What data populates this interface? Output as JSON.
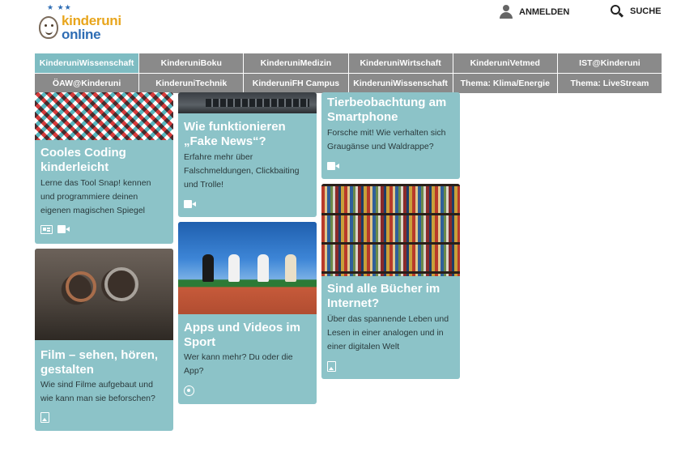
{
  "header": {
    "logo_line1": "kinderuni",
    "logo_line2": "online",
    "login_label": "ANMELDEN",
    "search_label": "SUCHE"
  },
  "nav": {
    "row1": [
      {
        "label": "KinderuniWissenschaft",
        "active": true
      },
      {
        "label": "KinderuniBoku"
      },
      {
        "label": "KinderuniMedizin"
      },
      {
        "label": "KinderuniWirtschaft"
      },
      {
        "label": "KinderuniVetmed"
      },
      {
        "label": "IST@Kinderuni"
      }
    ],
    "row2": [
      {
        "label": "ÖAW@Kinderuni"
      },
      {
        "label": "KinderuniTechnik"
      },
      {
        "label": "KinderuniFH Campus"
      },
      {
        "label": "KinderuniWissenschaft"
      },
      {
        "label": "Thema: Klima/Energie"
      },
      {
        "label": "Thema: LiveStream"
      }
    ]
  },
  "cards": {
    "coding": {
      "title": "Cooles Coding kinderleicht",
      "text": "Lerne das Tool Snap! kennen und programmiere deinen eigenen magischen Spiegel",
      "icons": [
        "document-icon",
        "video-icon"
      ]
    },
    "fakenews": {
      "title": "Wie funktionieren „Fake News“?",
      "text": "Erfahre mehr über Falschmeldungen, Clickbaiting und Trolle!",
      "icons": [
        "video-icon"
      ]
    },
    "tierbeobachtung": {
      "title": "Tierbeobachtung am Smartphone",
      "text": "Forsche mit! Wie verhalten sich Graugänse und Waldrappe?",
      "icons": [
        "video-icon"
      ]
    },
    "film": {
      "title": "Film – sehen, hören, gestalten",
      "text": "Wie sind Filme aufgebaut und wie kann man sie beforschen?",
      "icons": [
        "image-icon"
      ]
    },
    "sport": {
      "title": "Apps und Videos im Sport",
      "text": "Wer kann mehr? Du oder die App?",
      "icons": [
        "podcast-icon"
      ]
    },
    "buecher": {
      "title": "Sind alle Bücher im Internet?",
      "text": "Über das spannende Leben und Lesen in einer analogen und in einer digitalen Welt",
      "icons": [
        "image-icon"
      ]
    }
  },
  "colors": {
    "card_bg": "#8cc3c8",
    "nav_bg": "#8a8a8a",
    "nav_active": "#7ebcc2",
    "logo_orange": "#e8a51c",
    "logo_blue": "#2e6db4"
  }
}
